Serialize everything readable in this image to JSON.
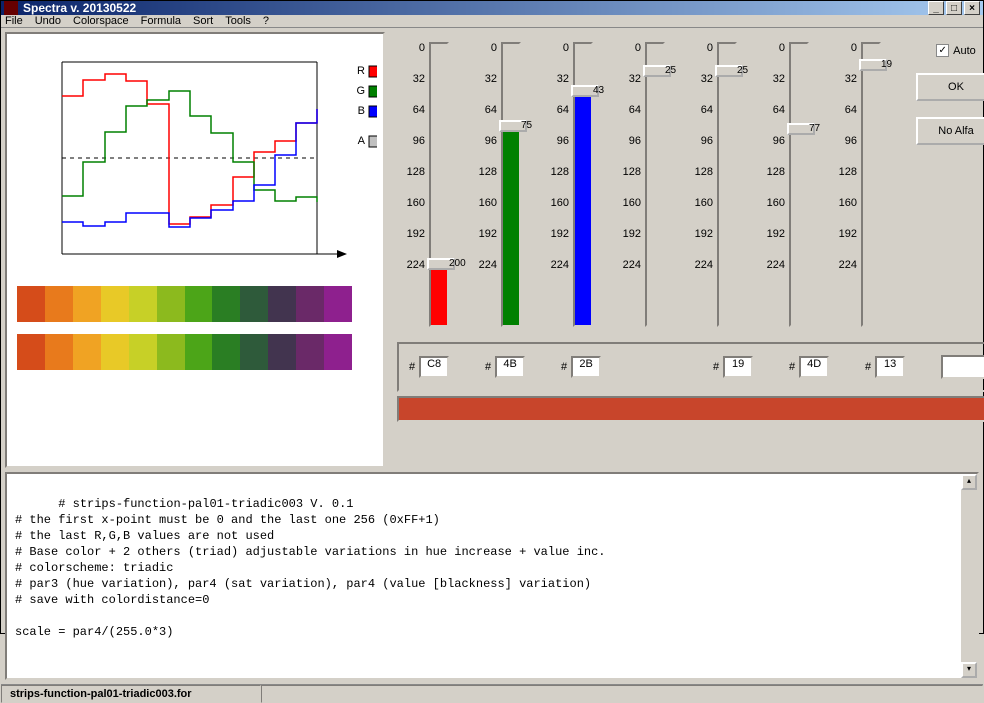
{
  "window": {
    "title": "Spectra v. 20130522"
  },
  "menubar": [
    "File",
    "Undo",
    "Colorspace",
    "Formula",
    "Sort",
    "Tools",
    "?"
  ],
  "legend": {
    "r": "R",
    "g": "G",
    "b": "B",
    "a": "A"
  },
  "ticks": [
    0,
    32,
    64,
    96,
    128,
    160,
    192,
    224
  ],
  "sliders": [
    {
      "color": "#ff0000",
      "value": 200,
      "label": "200",
      "hex": "C8"
    },
    {
      "color": "#008000",
      "value": 75,
      "label": "75",
      "hex": "4B"
    },
    {
      "color": "#0000ff",
      "value": 43,
      "label": "43",
      "hex": "2B"
    },
    {
      "color": null,
      "value": 25,
      "label": "25",
      "hex": null
    },
    {
      "color": null,
      "value": 25,
      "label": "25",
      "hex": "19"
    },
    {
      "color": null,
      "value": 77,
      "label": "77",
      "hex": "4D"
    },
    {
      "color": null,
      "value": 19,
      "label": "19",
      "hex": "13"
    }
  ],
  "checkbox": {
    "checked": true,
    "label": "Auto"
  },
  "buttons": {
    "ok": "OK",
    "noalfa": "No Alfa"
  },
  "hex_prefix": "#",
  "color_bar": "#c8452b",
  "gradient1": [
    "#d54c1a",
    "#e87a1c",
    "#f0a323",
    "#e8c927",
    "#c7d027",
    "#8cba1e",
    "#4ca518",
    "#2a7e23",
    "#2e5a3a",
    "#42344f",
    "#6a2968",
    "#8e208e"
  ],
  "gradient2": [
    "#d54c1a",
    "#e87a1c",
    "#f0a323",
    "#e8c927",
    "#c7d027",
    "#8cba1e",
    "#4ca518",
    "#2a7e23",
    "#2e5a3a",
    "#42344f",
    "#6a2968",
    "#8e208e"
  ],
  "script_text": "# strips-function-pal01-triadic003 V. 0.1\n# the first x-point must be 0 and the last one 256 (0xFF+1)\n# the last R,G,B values are not used\n# Base color + 2 others (triad) adjustable variations in hue increase + value inc.\n# colorscheme: triadic\n# par3 (hue variation), par4 (sat variation), par4 (value [blackness] variation)\n# save with colordistance=0\n\nscale = par4/(255.0*3)",
  "statusbar": {
    "file": "strips-function-pal01-triadic003.for"
  },
  "chart_data": {
    "type": "line",
    "title": "",
    "xlabel": "",
    "ylabel": "",
    "xlim": [
      0,
      256
    ],
    "ylim": [
      0,
      256
    ],
    "x": [
      0,
      21,
      43,
      64,
      85,
      107,
      128,
      149,
      171,
      192,
      213,
      235,
      256
    ],
    "series": [
      {
        "name": "R",
        "color": "#ff0000",
        "values": [
          210,
          233,
          240,
          232,
          200,
          40,
          50,
          67,
          106,
          140,
          155,
          180,
          200
        ]
      },
      {
        "name": "G",
        "color": "#008000",
        "values": [
          78,
          125,
          165,
          201,
          208,
          186,
          165,
          126,
          90,
          73,
          78,
          73,
          70
        ]
      },
      {
        "name": "B",
        "color": "#0000ff",
        "values": [
          43,
          38,
          43,
          55,
          55,
          38,
          50,
          60,
          73,
          95,
          135,
          180,
          200
        ]
      }
    ]
  }
}
